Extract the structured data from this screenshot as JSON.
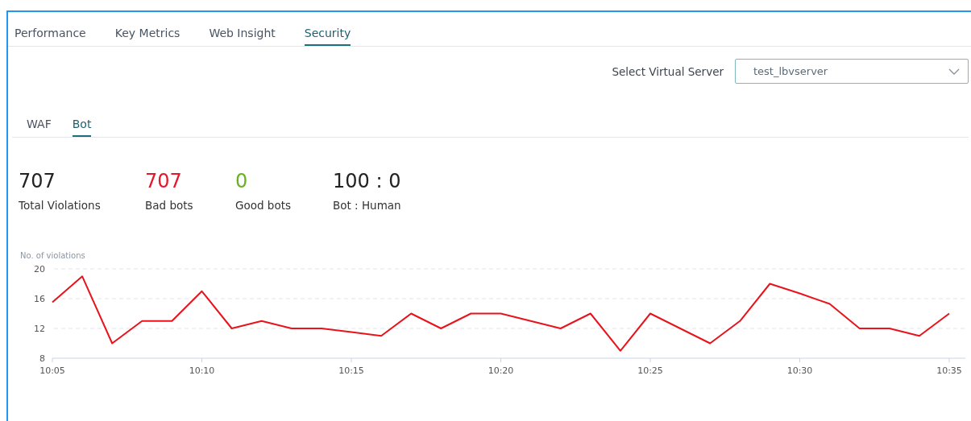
{
  "tabs": [
    {
      "label": "Performance",
      "selected": false
    },
    {
      "label": "Key Metrics",
      "selected": false
    },
    {
      "label": "Web Insight",
      "selected": false
    },
    {
      "label": "Security",
      "selected": true
    }
  ],
  "server_select": {
    "label": "Select Virtual Server",
    "value": "test_lbvserver"
  },
  "sub_tabs": [
    {
      "label": "WAF",
      "selected": false
    },
    {
      "label": "Bot",
      "selected": true
    }
  ],
  "stats": [
    {
      "value": "707",
      "label": "Total Violations",
      "color": "#222222"
    },
    {
      "value": "707",
      "label": "Bad bots",
      "color": "#e0192d"
    },
    {
      "value": "0",
      "label": "Good bots",
      "color": "#6ab023"
    },
    {
      "value": "100 : 0",
      "label": "Bot : Human",
      "color": "#222222"
    }
  ],
  "chart_data": {
    "type": "line",
    "ylabel": "No. of violations",
    "categories": [
      "10:05",
      null,
      null,
      null,
      null,
      "10:10",
      null,
      null,
      null,
      null,
      "10:15",
      null,
      null,
      null,
      null,
      "10:20",
      null,
      null,
      null,
      null,
      "10:25",
      null,
      null,
      null,
      null,
      "10:30",
      null,
      null,
      null,
      null,
      "10:35"
    ],
    "series": [
      {
        "color": "#e8131b",
        "values": [
          15.5,
          19,
          10,
          13,
          13,
          17,
          12,
          13,
          12,
          12,
          11.5,
          11,
          14,
          12,
          14,
          14,
          13,
          12,
          14,
          9,
          14,
          12,
          10,
          13,
          18,
          16.7,
          15.3,
          12,
          12,
          11,
          14
        ]
      }
    ],
    "ylim": [
      8,
      20
    ],
    "yticks": [
      8,
      12,
      16,
      20
    ]
  }
}
